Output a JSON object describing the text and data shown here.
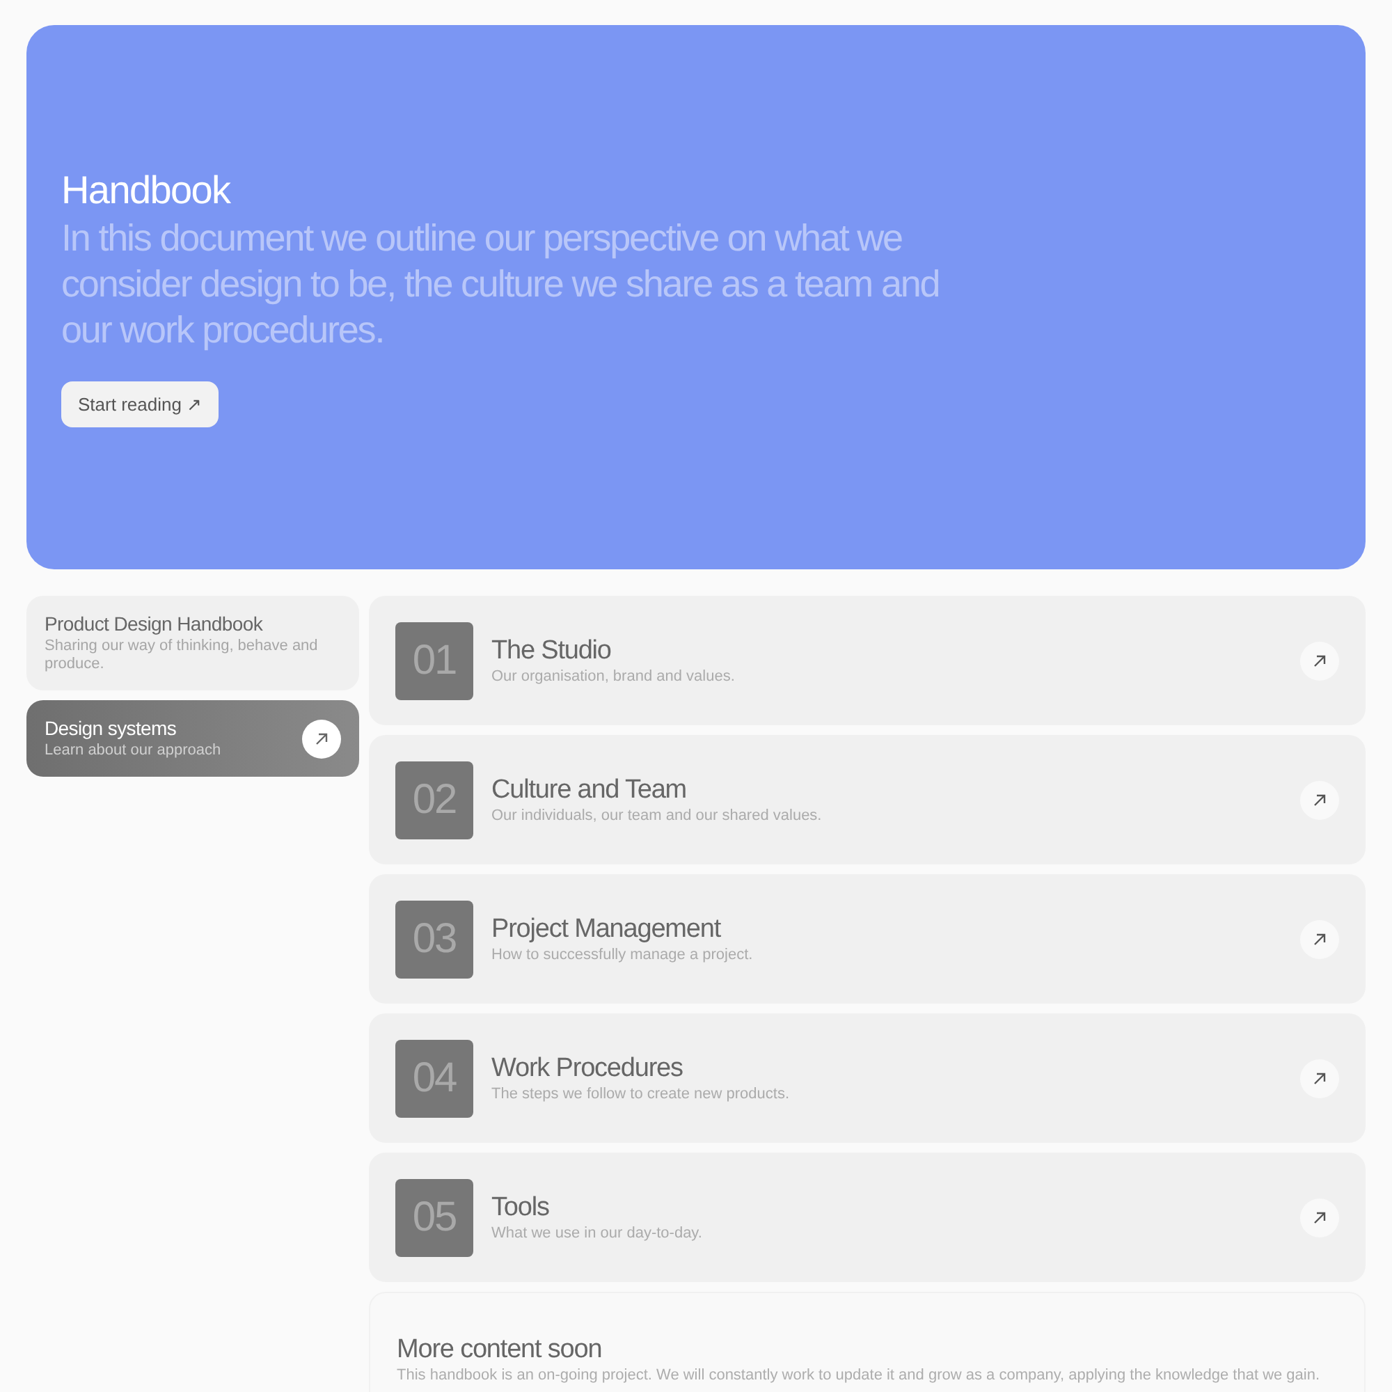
{
  "hero": {
    "title": "Handbook",
    "intro": "In this document we outline our perspective on what we consider design to be, the culture we share as a team and our work procedures.",
    "button": "Start reading ↗"
  },
  "sidebar": {
    "items": [
      {
        "title": "Product Design Handbook",
        "subtitle": "Sharing our way of thinking, behave and produce.",
        "selected": false
      },
      {
        "title": "Design systems",
        "subtitle": "Learn about our approach",
        "selected": true
      }
    ]
  },
  "chapters": [
    {
      "number": "01",
      "title": "The Studio",
      "description": "Our organisation, brand and values."
    },
    {
      "number": "02",
      "title": "Culture and Team",
      "description": "Our individuals, our team and our shared values."
    },
    {
      "number": "03",
      "title": "Project Management",
      "description": "How to successfully manage a project."
    },
    {
      "number": "04",
      "title": "Work Procedures",
      "description": "The steps we follow to create new products."
    },
    {
      "number": "05",
      "title": "Tools",
      "description": "What we use in our day-to-day."
    }
  ],
  "note": {
    "title": "More content soon",
    "text": "This handbook is an on-going project. We will constantly work to update it and grow as a company, applying the knowledge that we gain."
  }
}
